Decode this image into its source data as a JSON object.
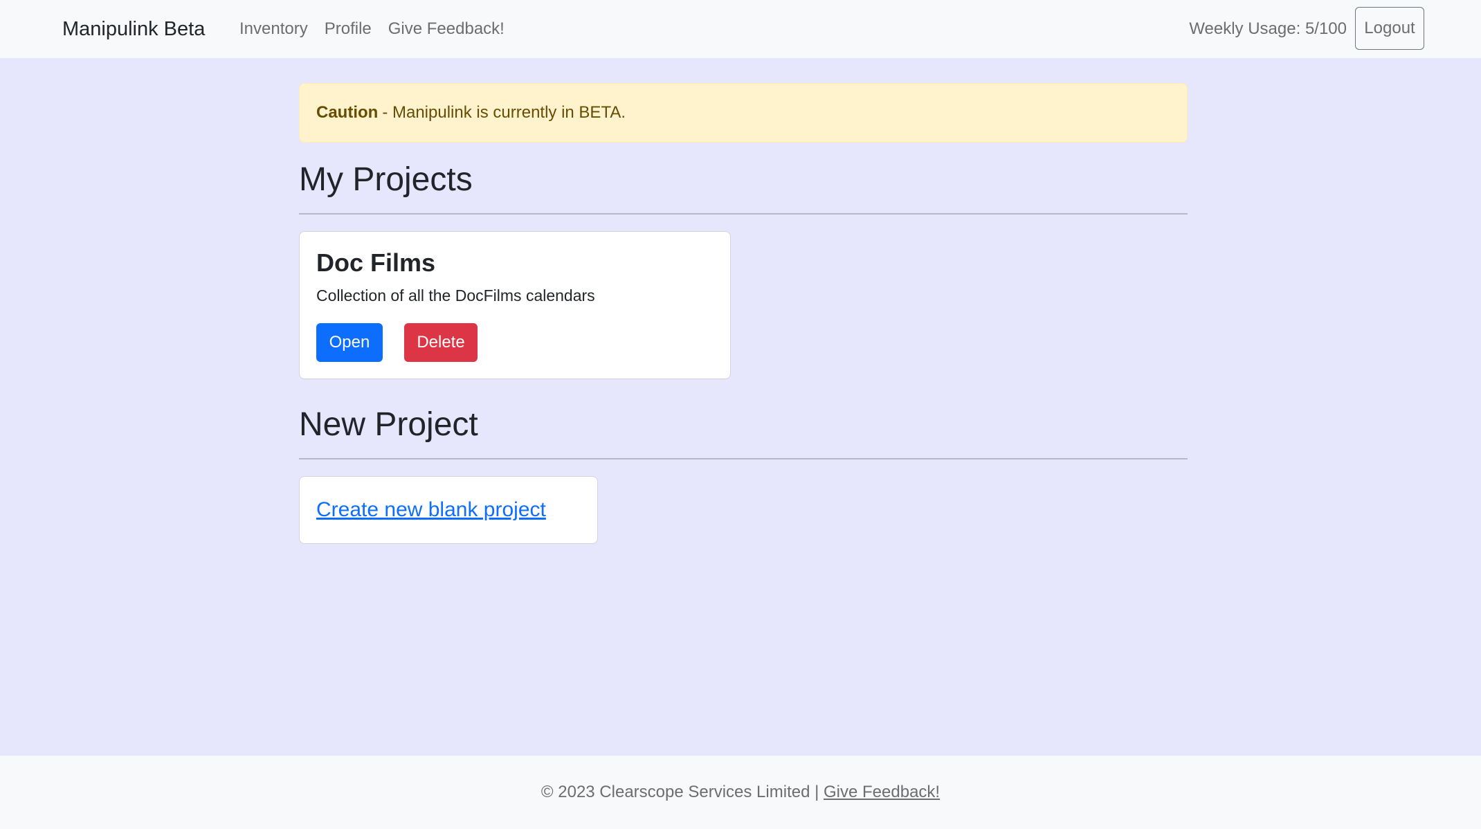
{
  "navbar": {
    "brand": "Manipulink Beta",
    "links": [
      "Inventory",
      "Profile",
      "Give Feedback!"
    ],
    "usage": "Weekly Usage: 5/100",
    "logout_label": "Logout"
  },
  "alert": {
    "strong": "Caution",
    "text": "- Manipulink is currently in BETA."
  },
  "projects": {
    "title": "My Projects",
    "items": [
      {
        "name": "Doc Films",
        "description": "Collection of all the DocFilms calendars",
        "open_label": "Open",
        "delete_label": "Delete"
      }
    ]
  },
  "new_project": {
    "title": "New Project",
    "link_label": "Create new blank project"
  },
  "footer": {
    "text": "© 2023 Clearscope Services Limited |",
    "link_label": "Give Feedback!"
  },
  "colors": {
    "background": "#e6e6fc",
    "primary": "#0d6efd",
    "danger": "#dc3545",
    "alert_bg": "#fff3cd"
  }
}
